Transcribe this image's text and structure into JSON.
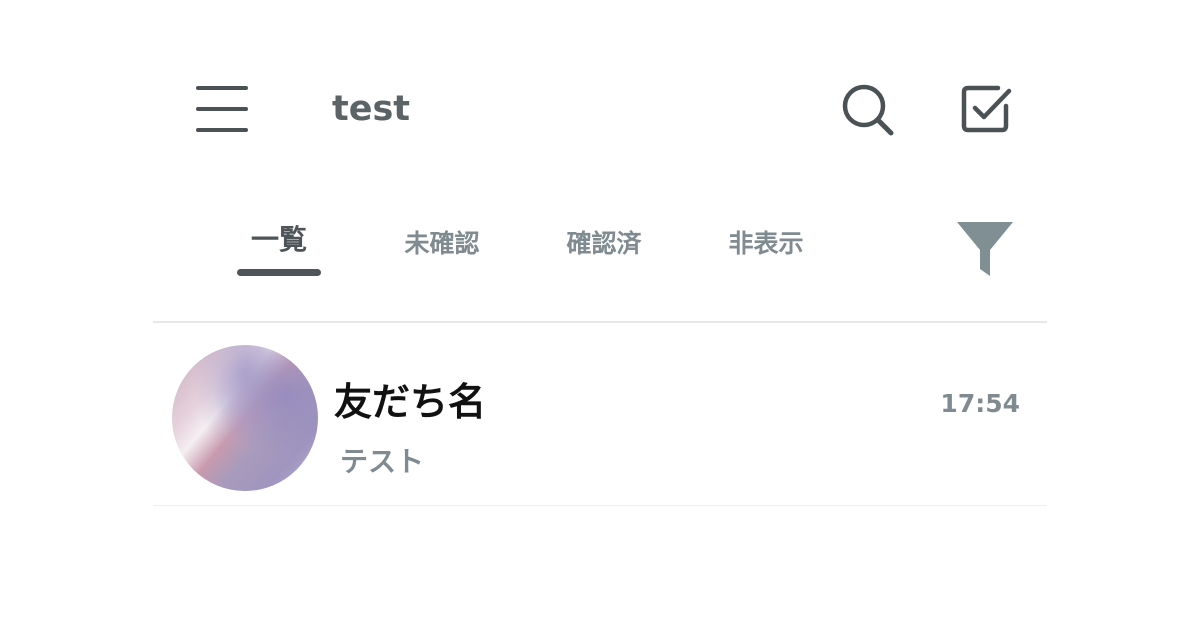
{
  "header": {
    "title": "test",
    "icons": [
      "menu-icon",
      "search-icon",
      "checkbox-icon"
    ]
  },
  "tabs": [
    {
      "label": "一覧",
      "active": true
    },
    {
      "label": "未確認",
      "active": false
    },
    {
      "label": "確認済",
      "active": false
    },
    {
      "label": "非表示",
      "active": false
    }
  ],
  "filter": {
    "icon": "filter-icon"
  },
  "chat_list": [
    {
      "name": "友だち名",
      "message": "テスト",
      "time": "17:54"
    }
  ],
  "colors": {
    "icon": "#4a5255",
    "active_tab": "#4d5558",
    "inactive_tab": "#7f8b90",
    "filter": "#7f8f94",
    "divider": "#e6e8e9"
  }
}
